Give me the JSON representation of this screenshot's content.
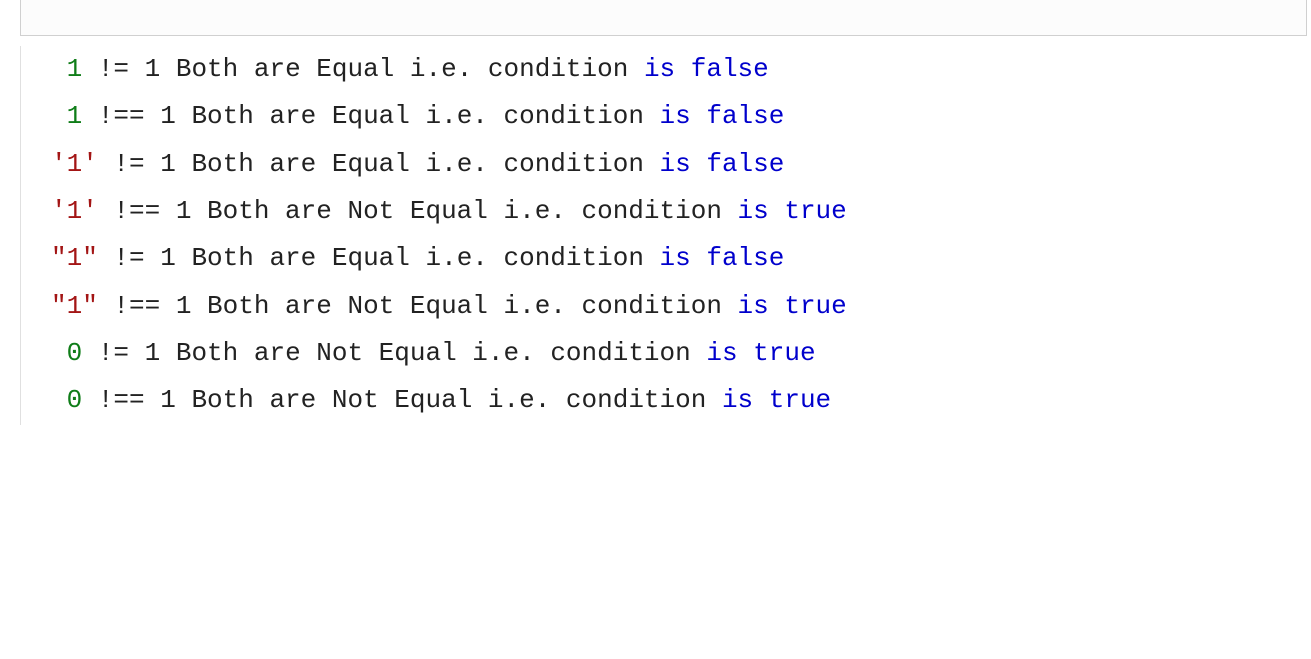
{
  "lines": [
    {
      "left_pad": " ",
      "left": {
        "kind": "num",
        "text": "1"
      },
      "op": " != ",
      "right": "1",
      "msg": " Both are Equal i.e. condition ",
      "kw": "is false"
    },
    {
      "left_pad": " ",
      "left": {
        "kind": "num",
        "text": "1"
      },
      "op": " !== ",
      "right": "1",
      "msg": " Both are Equal i.e. condition ",
      "kw": "is false"
    },
    {
      "left_pad": "",
      "left": {
        "kind": "str",
        "text": "'1'"
      },
      "op": " != ",
      "right": "1",
      "msg": " Both are Equal i.e. condition ",
      "kw": "is false"
    },
    {
      "left_pad": "",
      "left": {
        "kind": "str",
        "text": "'1'"
      },
      "op": " !== ",
      "right": "1",
      "msg": " Both are Not Equal i.e. condition ",
      "kw": "is true"
    },
    {
      "left_pad": "",
      "left": {
        "kind": "str",
        "text": "\"1\""
      },
      "op": " != ",
      "right": "1",
      "msg": " Both are Equal i.e. condition ",
      "kw": "is false"
    },
    {
      "left_pad": "",
      "left": {
        "kind": "str",
        "text": "\"1\""
      },
      "op": " !== ",
      "right": "1",
      "msg": " Both are Not Equal i.e. condition ",
      "kw": "is true"
    },
    {
      "left_pad": " ",
      "left": {
        "kind": "num",
        "text": "0"
      },
      "op": " != ",
      "right": "1",
      "msg": " Both are Not Equal i.e. condition ",
      "kw": "is true"
    },
    {
      "left_pad": " ",
      "left": {
        "kind": "num",
        "text": "0"
      },
      "op": " !== ",
      "right": "1",
      "msg": " Both are Not Equal i.e. condition ",
      "kw": "is true"
    }
  ]
}
